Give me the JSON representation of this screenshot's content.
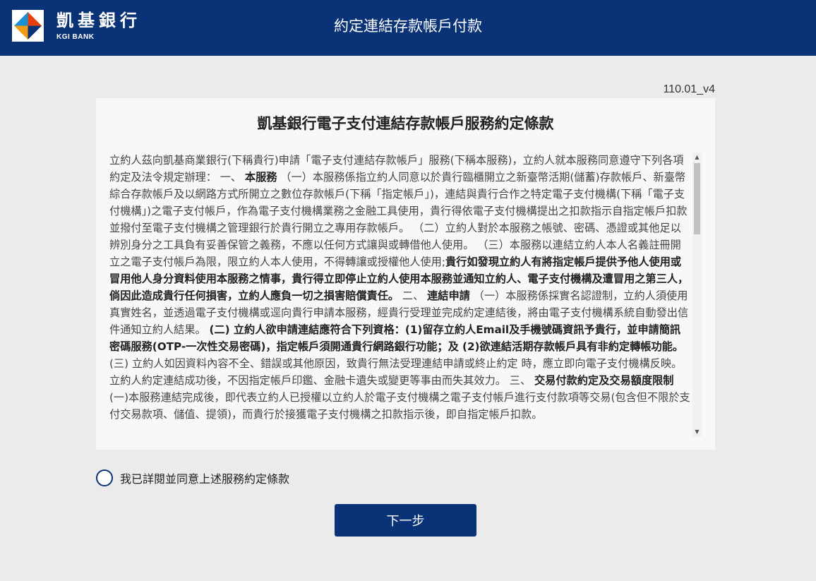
{
  "header": {
    "logo_cn": "凱基銀行",
    "logo_en": "KGI BANK",
    "logo_icon": "kgi-diamond-logo",
    "title": "約定連結存款帳戶付款",
    "bg_color": "#0a3377"
  },
  "version": "110.01_v4",
  "progress_colors": [
    "#e8400c",
    "#f39c12",
    "#4caf3f"
  ],
  "terms": {
    "title": "凱基銀行電子支付連結存款帳戶服務約定條款",
    "segments": [
      {
        "text": "立約人茲向凱基商業銀行(下稱貴行)申請「電子支付連結存款帳戶」服務(下稱本服務)，立約人就本服務同意遵守下列各項約定及法令規定辦理： 一、 ",
        "bold": false
      },
      {
        "text": "本服務",
        "bold": true
      },
      {
        "text": " （一）本服務係指立約人同意以於貴行臨櫃開立之新臺幣活期(儲蓄)存款帳戶、新臺幣綜合存款帳戶及以網路方式所開立之數位存款帳戶(下稱「指定帳戶」)，連結與貴行合作之特定電子支付機構(下稱「電子支付機構」)之電子支付帳戶，作為電子支付機構業務之金融工具使用，貴行得依電子支付機構提出之扣款指示自指定帳戶扣款並撥付至電子支付機構之管理銀行於貴行開立之專用存款帳戶。 （二）立約人對於本服務之帳號、密碼、憑證或其他足以辨別身分之工具負有妥善保管之義務，不應以任何方式讓與或轉借他人使用。 （三）本服務以連結立約人本人名義註冊開立之電子支付帳戶為限，限立約人本人使用，不得轉讓或授權他人使用;",
        "bold": false
      },
      {
        "text": "貴行如發現立約人有將指定帳戶提供予他人使用或冒用他人身分資料使用本服務之情事，貴行得立即停止立約人使用本服務並通知立約人、電子支付機構及遭冒用之第三人，倘因此造成貴行任何損害，立約人應負一切之損害賠償責任。",
        "bold": true
      },
      {
        "text": " 二、 ",
        "bold": false
      },
      {
        "text": "連結申請",
        "bold": true
      },
      {
        "text": " （一）本服務係採實名認證制，立約人須使用真實姓名，並透過電子支付機構或逕向貴行申請本服務，經貴行受理並完成約定連結後，將由電子支付機構系統自動發出信件通知立約人結果。 ",
        "bold": false
      },
      {
        "text": "(二) 立約人欲申請連結應符合下列資格：(1)留存立約人Email及手機號碼資訊予貴行，並申請簡訊密碼服務(OTP-一次性交易密碼)，指定帳戶須開通貴行網路銀行功能；及 (2)欲連結活期存款帳戶具有非約定轉帳功能。",
        "bold": true
      },
      {
        "text": " (三) 立約人如因資料內容不全、錯誤或其他原因，致貴行無法受理連結申請或終止約定 時，應立即向電子支付機構反映。立約人約定連結成功後，不因指定帳戶印鑑、金融卡遺失或變更等事由而失其效力。 三、 ",
        "bold": false
      },
      {
        "text": "交易付款約定及交易額度限制",
        "bold": true
      },
      {
        "text": " (一)本服務連結完成後，即代表立約人已授權以立約人於電子支付機構之電子支付帳戶進行支付款項等交易(包含但不限於支付交易款項、儲值、提領)，而貴行於接獲電子支付機構之扣款指示後，即自指定帳戶扣款。",
        "bold": false
      }
    ]
  },
  "agree": {
    "label": "我已詳閱並同意上述服務約定條款",
    "checked": false
  },
  "next_button": "下一步"
}
